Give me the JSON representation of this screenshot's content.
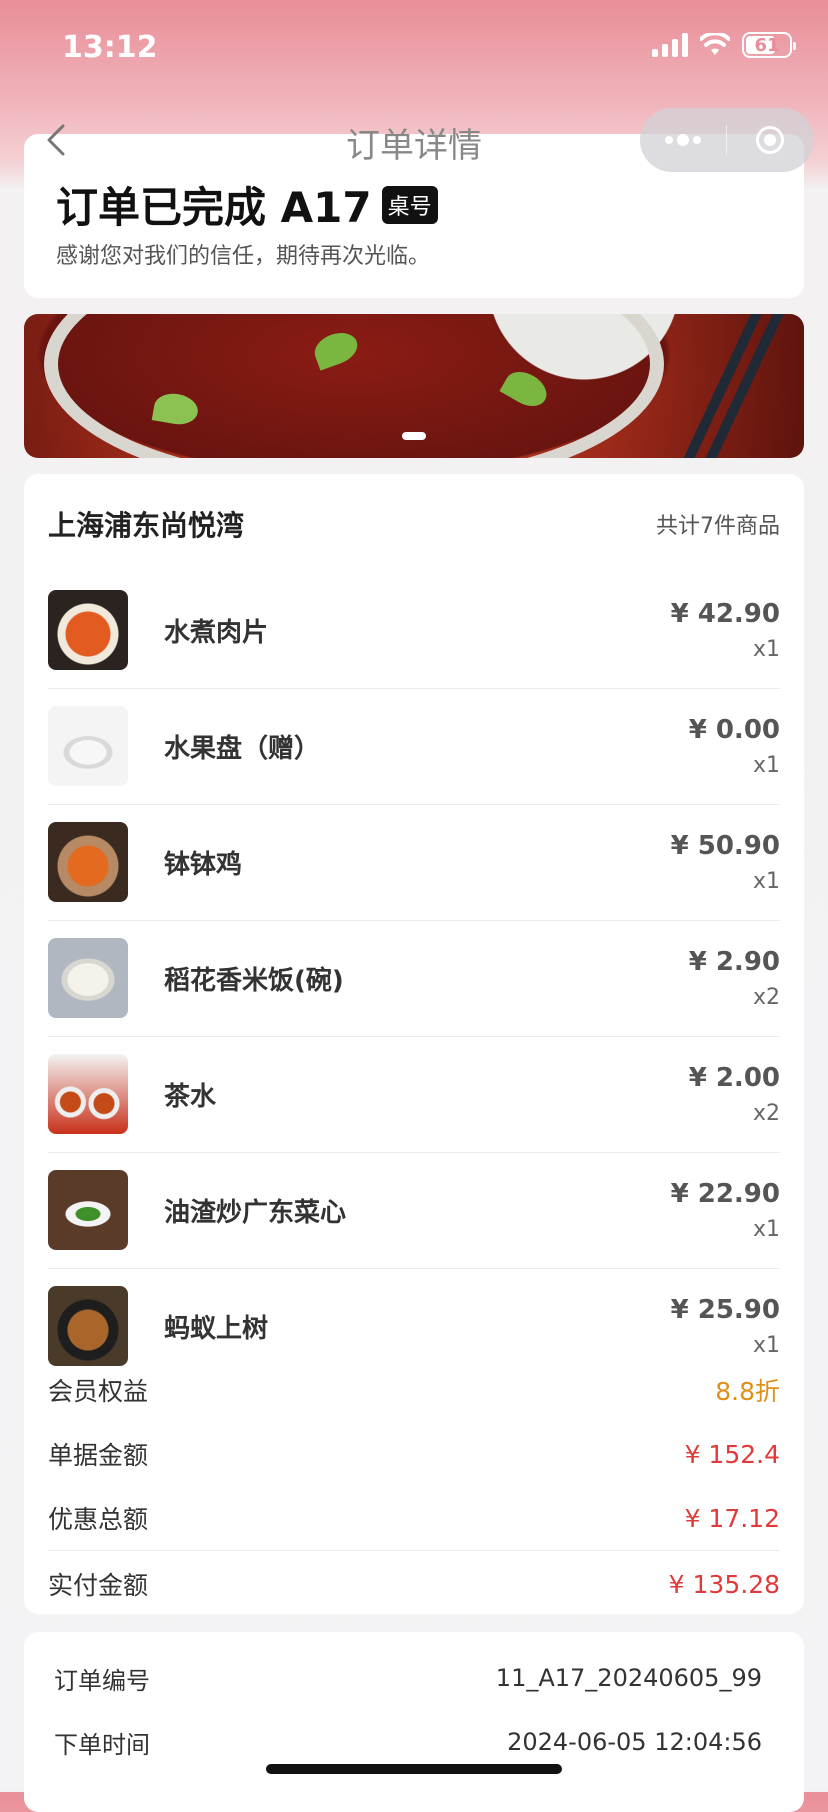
{
  "status_bar": {
    "time": "13:12",
    "battery": "61"
  },
  "nav": {
    "title": "订单详情"
  },
  "order_status": {
    "title": "订单已完成 A17",
    "badge": "桌号",
    "subtitle": "感谢您对我们的信任，期待再次光临。"
  },
  "store": {
    "name": "上海浦东尚悦湾",
    "item_count": "共计7件商品"
  },
  "items": [
    {
      "name": "水煮肉片",
      "price": "¥ 42.90",
      "qty": "x1"
    },
    {
      "name": "水果盘（赠）",
      "price": "¥ 0.00",
      "qty": "x1"
    },
    {
      "name": "钵钵鸡",
      "price": "¥ 50.90",
      "qty": "x1"
    },
    {
      "name": "稻花香米饭(碗)",
      "price": "¥ 2.90",
      "qty": "x2"
    },
    {
      "name": "茶水",
      "price": "¥ 2.00",
      "qty": "x2"
    },
    {
      "name": "油渣炒广东菜心",
      "price": "¥ 22.90",
      "qty": "x1"
    },
    {
      "name": "蚂蚁上树",
      "price": "¥ 25.90",
      "qty": "x1"
    }
  ],
  "summary": {
    "member_label": "会员权益",
    "member_value": "8.8折",
    "bill_label": "单据金额",
    "bill_value": "¥ 152.4",
    "discount_label": "优惠总额",
    "discount_value": "¥ 17.12",
    "paid_label": "实付金额",
    "paid_value": "¥ 135.28"
  },
  "order_info": {
    "number_label": "订单编号",
    "number_value": "11_A17_20240605_99",
    "time_label": "下单时间",
    "time_value": "2024-06-05 12:04:56"
  },
  "icons": {
    "back": "chevron-left-icon",
    "more": "more-dots-icon",
    "close": "miniprogram-close-icon",
    "signal": "signal-icon",
    "wifi": "wifi-icon",
    "battery": "battery-icon"
  },
  "colors": {
    "accent_red": "#e03a3a",
    "accent_orange": "#e0901a",
    "header_gradient_top": "#e98e98"
  }
}
